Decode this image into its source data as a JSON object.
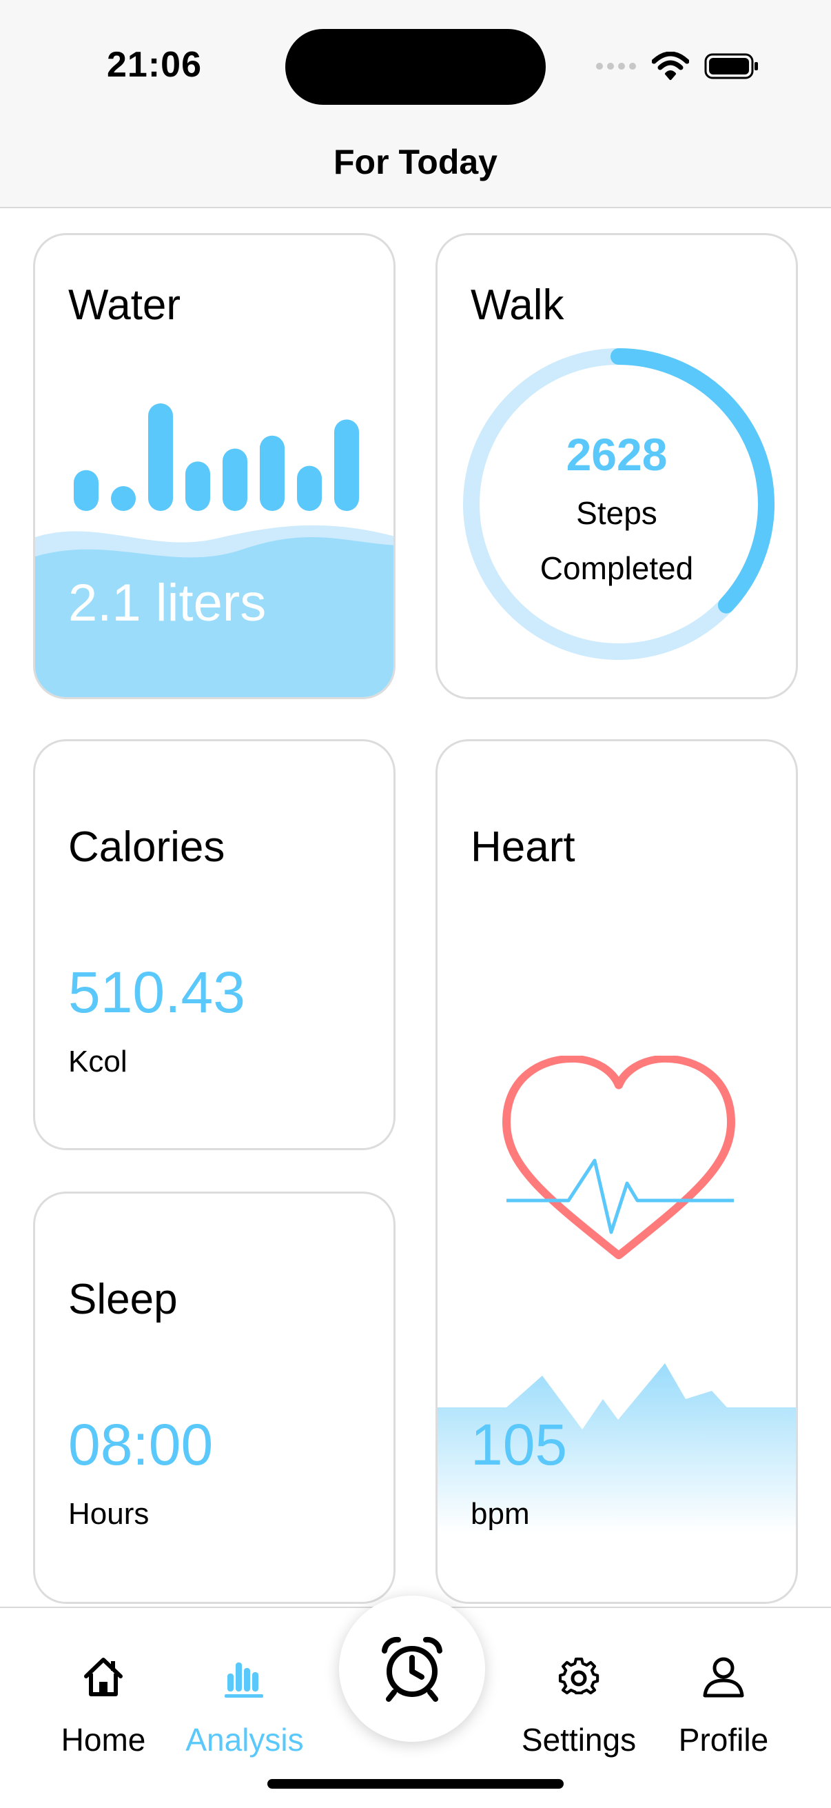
{
  "status_bar": {
    "time": "21:06",
    "icons": [
      "signal-icon",
      "wifi-icon",
      "battery-icon"
    ]
  },
  "header": {
    "title": "For Today"
  },
  "cards": {
    "water": {
      "title": "Water",
      "value_text": "2.1 liters",
      "bar_levels": [
        0.38,
        0.2,
        1.0,
        0.46,
        0.58,
        0.7,
        0.42,
        0.85
      ]
    },
    "walk": {
      "title": "Walk",
      "steps": "2628",
      "label_line1": "Steps",
      "label_line2": "Completed",
      "progress_fraction": 0.37
    },
    "calories": {
      "title": "Calories",
      "value": "510.43",
      "unit": "Kcol"
    },
    "heart": {
      "title": "Heart",
      "value": "105",
      "unit": "bpm"
    },
    "sleep": {
      "title": "Sleep",
      "value": "08:00",
      "unit": "Hours"
    }
  },
  "tabbar": {
    "tabs": [
      {
        "label": "Home",
        "icon": "home-icon",
        "active": false
      },
      {
        "label": "Analysis",
        "icon": "bar-chart-icon",
        "active": true
      },
      {
        "label": "Settings",
        "icon": "gear-icon",
        "active": false
      },
      {
        "label": "Profile",
        "icon": "person-icon",
        "active": false
      }
    ],
    "center_button_icon": "alarm-clock-icon"
  },
  "colors": {
    "accent": "#5ac8fa",
    "accent_light": "#cdebfc",
    "heart_red": "#ff7b7b",
    "card_border": "#dcdcdc"
  }
}
